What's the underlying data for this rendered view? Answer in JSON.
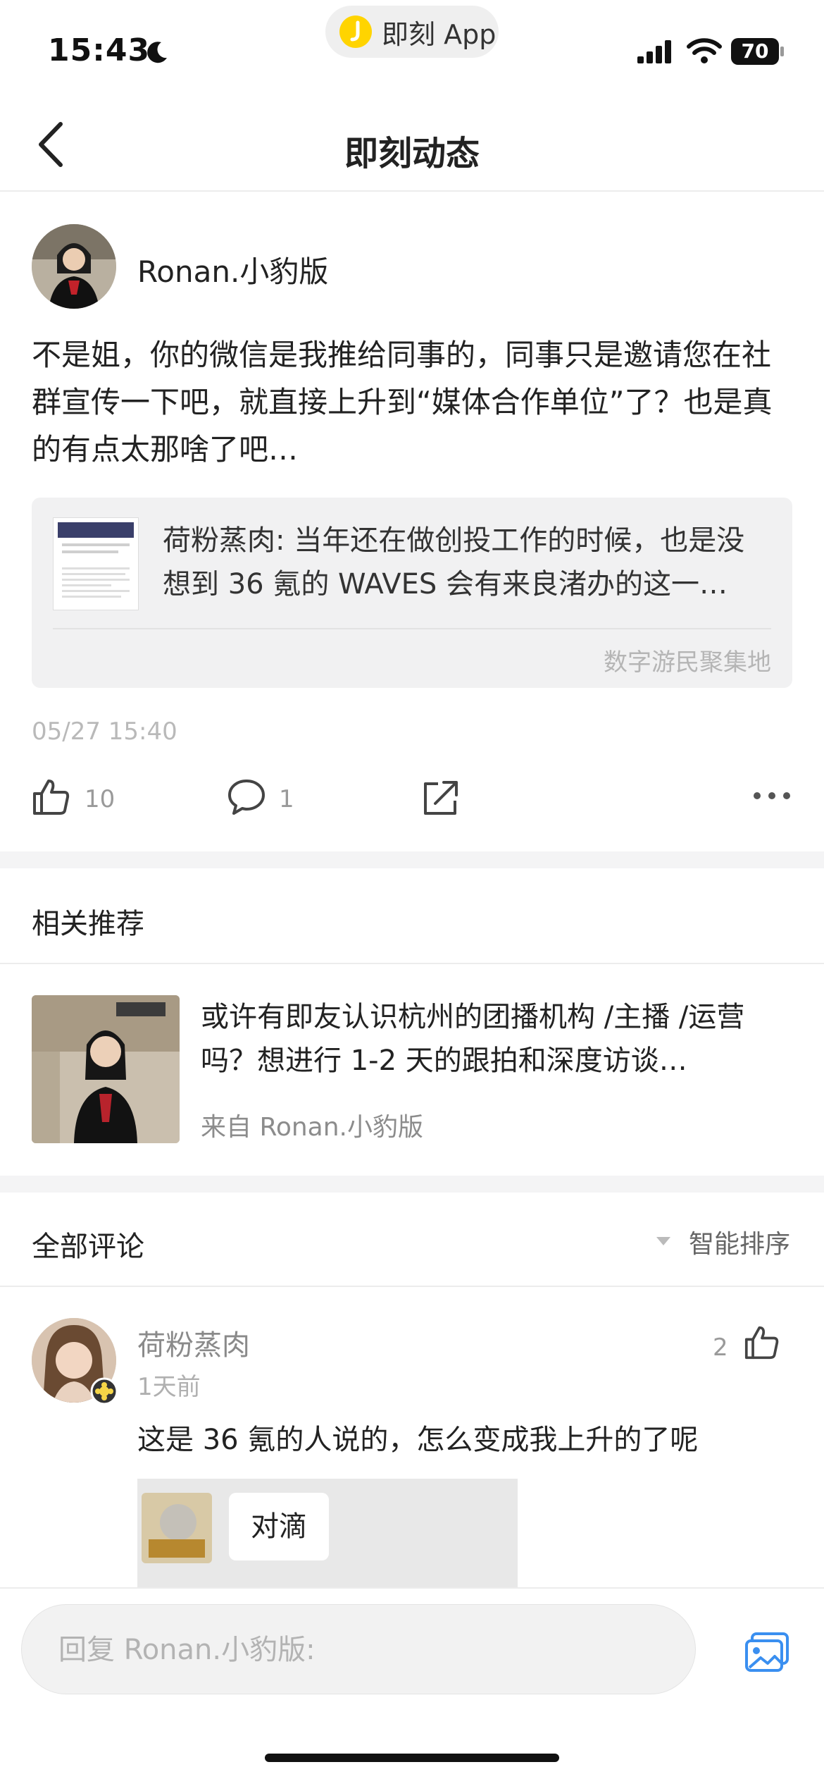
{
  "status_bar": {
    "time": "15:43",
    "app_pill": "即刻 App",
    "battery": "70"
  },
  "header": {
    "title": "即刻动态"
  },
  "post": {
    "author": "Ronan.小豹版",
    "text": "不是姐，你的微信是我推给同事的，同事只是邀请您在社群宣传一下吧，就直接上升到“媒体合作单位”了？也是真的有点太那啥了吧…",
    "repost": {
      "text": "荷粉蒸肉: 当年还在做创投工作的时候，也是没想到 36 氪的 WAVES 会有来良渚办的这一…",
      "topic": "数字游民聚集地"
    },
    "timestamp": "05/27 15:40",
    "likes": "10",
    "comments": "1"
  },
  "related": {
    "title": "相关推荐",
    "item": {
      "text": "或许有即友认识杭州的团播机构 /主播 /运营吗？想进行 1-2 天的跟拍和深度访谈…",
      "source": "来自 Ronan.小豹版"
    }
  },
  "comments_section": {
    "title": "全部评论",
    "sort_label": "智能排序",
    "items": [
      {
        "author": "荷粉蒸肉",
        "time": "1天前",
        "text": "这是 36 氪的人说的，怎么变成我上升的了呢",
        "likes": "2",
        "reply_quote": "对滴"
      }
    ]
  },
  "reply_input": {
    "placeholder": "回复 Ronan.小豹版:"
  },
  "icons": [
    "back-icon",
    "moon-icon",
    "signal-icon",
    "wifi-icon",
    "like-icon",
    "comment-icon",
    "share-icon",
    "more-icon",
    "sort-triangle-icon",
    "image-picker-icon"
  ],
  "colors": {
    "brand_yellow": "#ffd400",
    "accent_blue": "#3a8ff0"
  }
}
